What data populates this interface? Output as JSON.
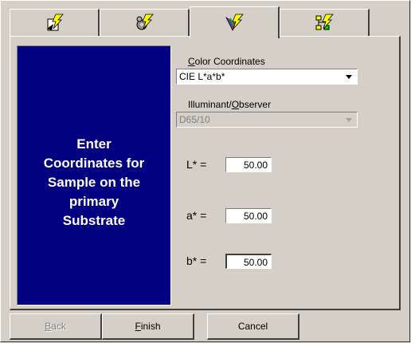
{
  "tabs": [
    {
      "icon": "lightning-page-icon"
    },
    {
      "icon": "lightning-gear-icon"
    },
    {
      "icon": "lightning-color-icon"
    },
    {
      "icon": "lightning-tree-icon"
    }
  ],
  "instructions": "Enter\nCoordinates for\nSample on the\nprimary\nSubstrate",
  "color_coordinates": {
    "label_accel": "C",
    "label_rest": "olor Coordinates",
    "value": "CIE L*a*b*"
  },
  "illuminant": {
    "label_pre": "Illuminant/",
    "label_accel": "O",
    "label_post": "bserver",
    "value": "D65/10"
  },
  "fields": {
    "l": {
      "label": "L* =",
      "value": "50.00"
    },
    "a": {
      "label": "a* =",
      "value": "50.00"
    },
    "b": {
      "label": "b* =",
      "value": "50.00"
    }
  },
  "buttons": {
    "back_accel": "B",
    "back_rest": "ack",
    "finish_accel": "F",
    "finish_rest": "inish",
    "cancel": "Cancel"
  }
}
